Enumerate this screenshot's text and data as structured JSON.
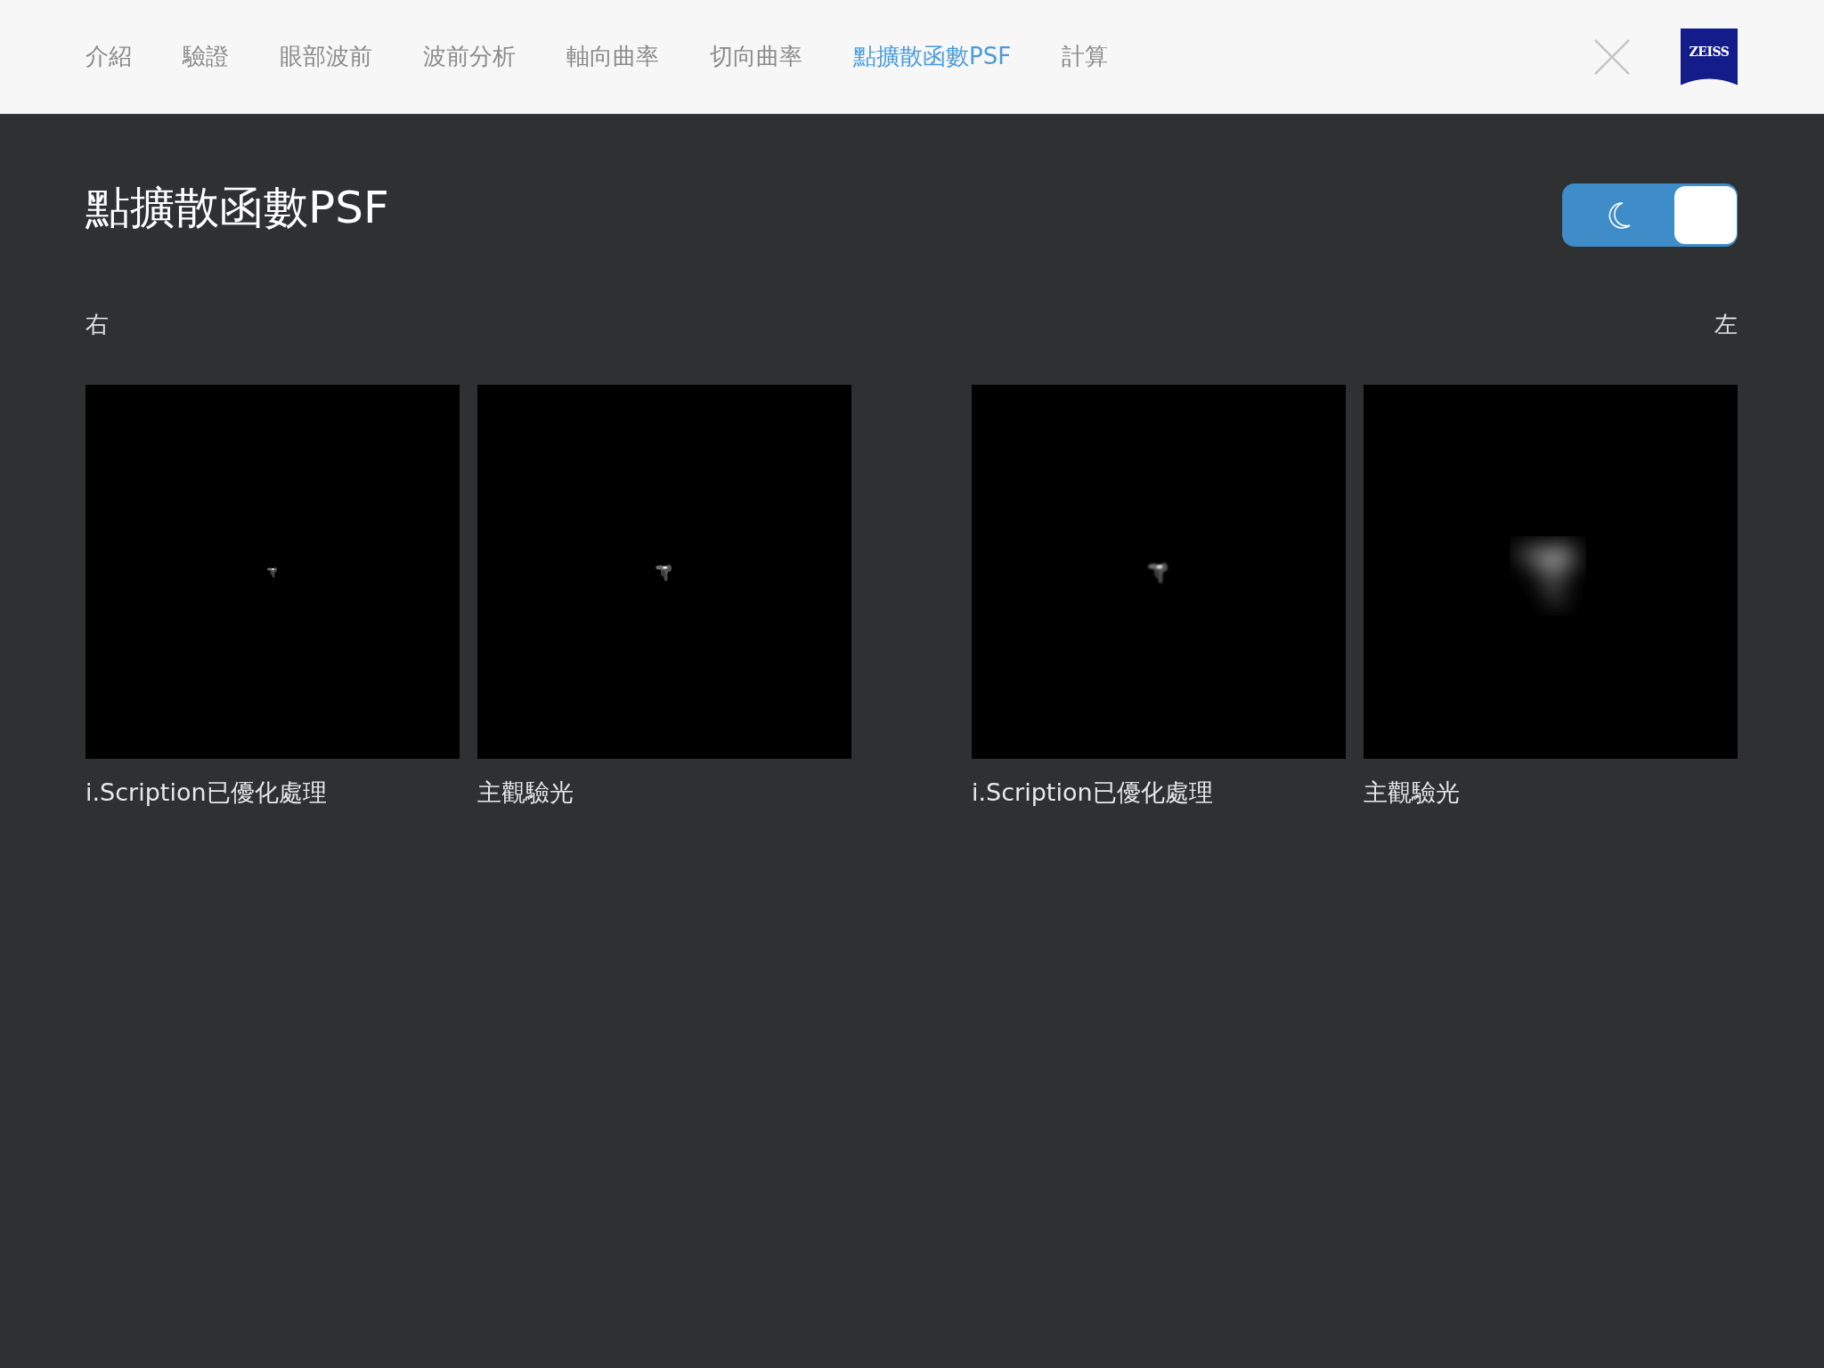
{
  "tabs": [
    {
      "label": "介紹",
      "selected": false
    },
    {
      "label": "驗證",
      "selected": false
    },
    {
      "label": "眼部波前",
      "selected": false
    },
    {
      "label": "波前分析",
      "selected": false
    },
    {
      "label": "軸向曲率",
      "selected": false
    },
    {
      "label": "切向曲率",
      "selected": false
    },
    {
      "label": "點擴散函數PSF",
      "selected": true
    },
    {
      "label": "計算",
      "selected": false
    }
  ],
  "logo": {
    "text": "ZEISS"
  },
  "page_title": "點擴散函數PSF",
  "dark_mode": {
    "on": true
  },
  "eyes": [
    {
      "label": "右",
      "images": [
        {
          "kind": "picture",
          "caption": "i.Scription已優化處理"
        },
        {
          "kind": "picture",
          "caption": "主觀驗光"
        }
      ]
    },
    {
      "label": "左",
      "images": [
        {
          "kind": "picture",
          "caption": "i.Scription已優化處理"
        },
        {
          "kind": "picture",
          "caption": "主觀驗光"
        }
      ]
    }
  ]
}
